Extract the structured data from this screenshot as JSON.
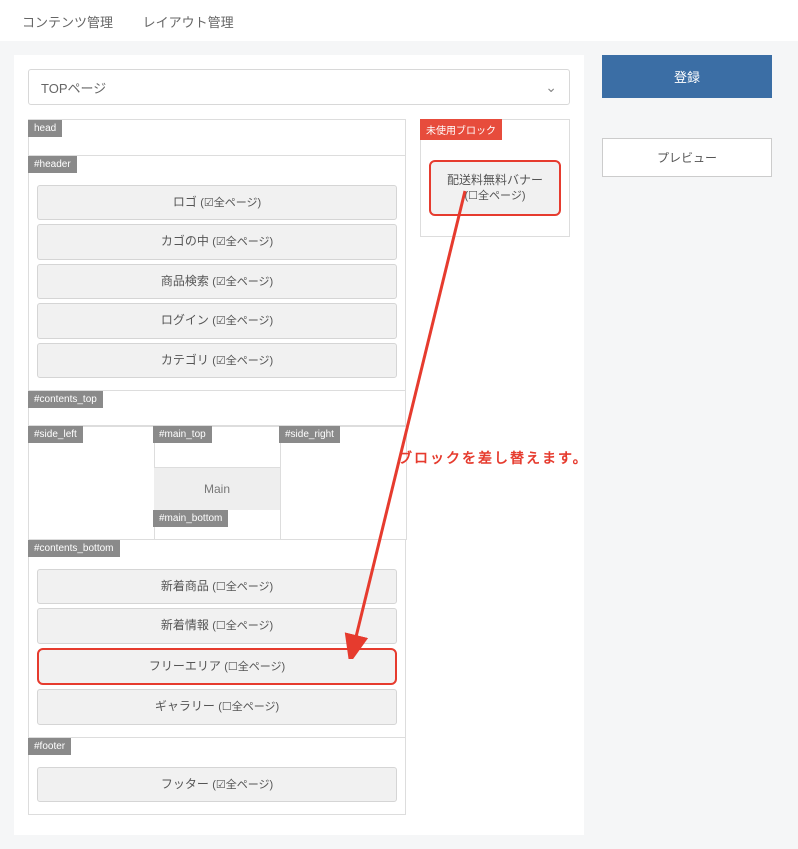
{
  "tabs": {
    "content": "コンテンツ管理",
    "layout": "レイアウト管理"
  },
  "page_select": {
    "value": "TOPページ"
  },
  "regions": {
    "head": "head",
    "header": "#header",
    "contents_top": "#contents_top",
    "side_left": "#side_left",
    "main_top": "#main_top",
    "side_right": "#side_right",
    "main_label": "Main",
    "main_bottom": "#main_bottom",
    "contents_bottom": "#contents_bottom",
    "footer": "#footer",
    "unused": "未使用ブロック"
  },
  "header_blocks": [
    {
      "name": "ロゴ",
      "scope": "(☑全ページ)"
    },
    {
      "name": "カゴの中",
      "scope": "(☑全ページ)"
    },
    {
      "name": "商品検索",
      "scope": "(☑全ページ)"
    },
    {
      "name": "ログイン",
      "scope": "(☑全ページ)"
    },
    {
      "name": "カテゴリ",
      "scope": "(☑全ページ)"
    }
  ],
  "bottom_blocks": [
    {
      "name": "新着商品",
      "scope": "(☐全ページ)"
    },
    {
      "name": "新着情報",
      "scope": "(☐全ページ)"
    },
    {
      "name": "フリーエリア",
      "scope": "(☐全ページ)"
    },
    {
      "name": "ギャラリー",
      "scope": "(☐全ページ)"
    }
  ],
  "footer_blocks": [
    {
      "name": "フッター",
      "scope": "(☑全ページ)"
    }
  ],
  "unused_blocks": [
    {
      "line1": "配送料無料バナー",
      "line2": "(☐全ページ)"
    }
  ],
  "buttons": {
    "register": "登録",
    "preview": "プレビュー"
  },
  "annotation": "ブロックを差し替えます。"
}
